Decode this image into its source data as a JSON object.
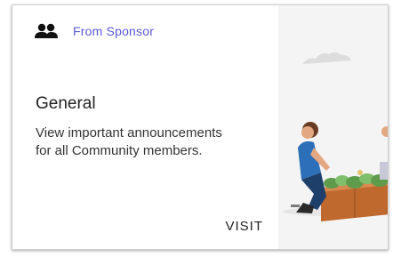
{
  "card": {
    "sponsor_icon": "people-group-icon",
    "sponsor_label": "From Sponsor",
    "title": "General",
    "description": "View important announcements for all Community members.",
    "action_label": "VISIT",
    "illustration": "community-gardening-illustration"
  },
  "colors": {
    "sponsor_text": "#5a5ad6",
    "illustration_bg": "#f4f4f4",
    "accent_blue": "#2d6fb8",
    "box_brown": "#c0692f"
  }
}
